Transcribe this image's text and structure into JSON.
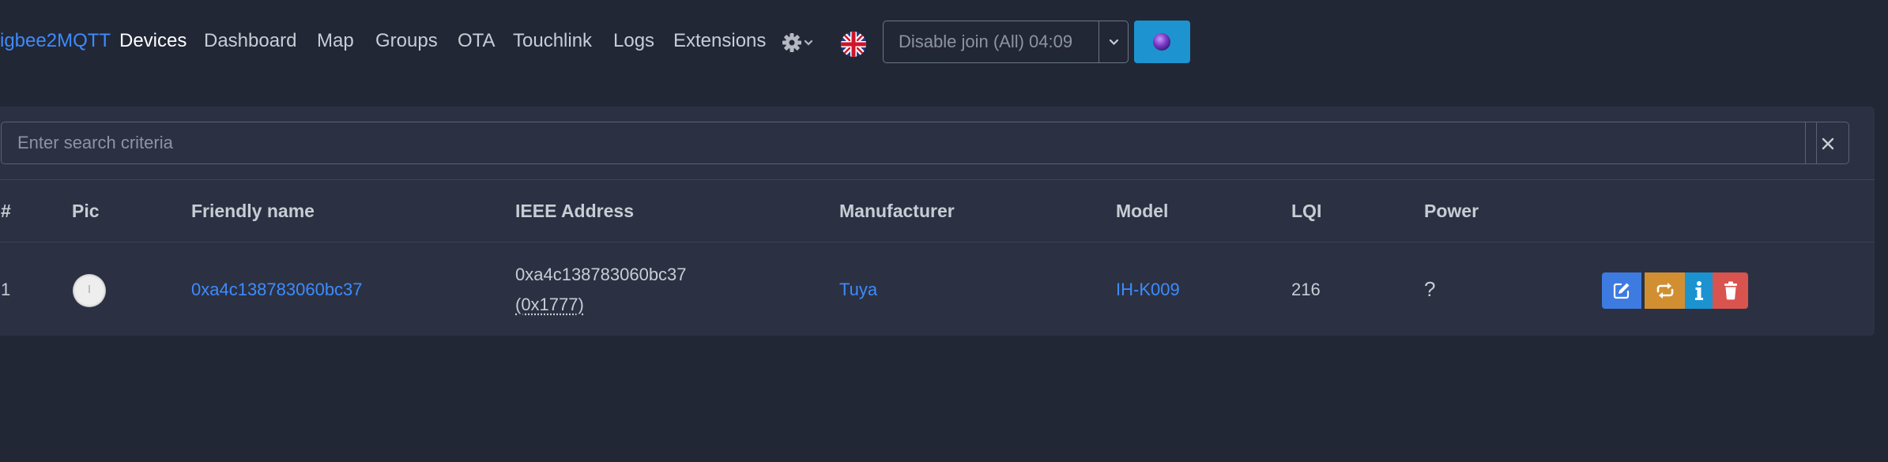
{
  "navbar": {
    "brand": "igbee2MQTT",
    "links": [
      {
        "label": "Devices"
      },
      {
        "label": "Dashboard"
      },
      {
        "label": "Map"
      },
      {
        "label": "Groups"
      },
      {
        "label": "OTA"
      },
      {
        "label": "Touchlink"
      },
      {
        "label": "Logs"
      },
      {
        "label": "Extensions"
      }
    ],
    "settings_icon": "gear-icon",
    "language_icon": "uk-flag-icon",
    "join_button_label": "Disable join (All) 04:09",
    "status_icon": "status-ball-icon"
  },
  "search": {
    "placeholder": "Enter search criteria",
    "value": "",
    "clear_icon": "close-icon"
  },
  "table": {
    "columns": [
      "#",
      "Pic",
      "Friendly name",
      "IEEE Address",
      "Manufacturer",
      "Model",
      "LQI",
      "Power"
    ],
    "rows": [
      {
        "index": "1",
        "friendly_name": "0xa4c138783060bc37",
        "ieee_address": "0xa4c138783060bc37",
        "network_address": "(0x1777)",
        "manufacturer": "Tuya",
        "model": "IH-K009",
        "lqi": "216",
        "power": "?"
      }
    ]
  },
  "row_actions": [
    "edit-icon",
    "reconfigure-icon",
    "info-icon",
    "trash-icon"
  ],
  "colors": {
    "background": "#222736",
    "card": "#2b3142",
    "link": "#3d8bfd",
    "edit": "#3d7be0",
    "reconfigure": "#d18f32",
    "info": "#1b93d1",
    "delete": "#d9534f"
  }
}
